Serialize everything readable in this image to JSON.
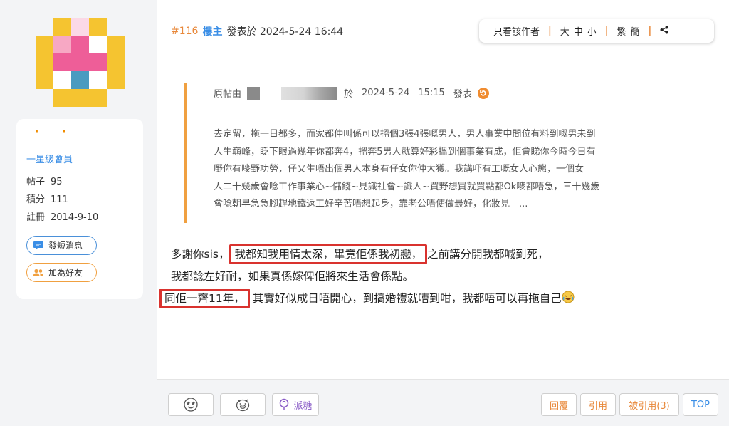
{
  "post": {
    "floor": "#116",
    "author_role": "樓主",
    "posted_at": "發表於 2024-5-24 16:44"
  },
  "toolbar": {
    "author_only": "只看該作者",
    "font_size": "大中小",
    "script": "繁簡"
  },
  "profile": {
    "rank": "一星級會員",
    "posts_label": "帖子",
    "posts_value": "95",
    "points_label": "積分",
    "points_value": "111",
    "registered_label": "註冊",
    "registered_value": "2014-9-10",
    "send_message": "發短消息",
    "add_friend": "加為好友"
  },
  "quote": {
    "prefix": "原帖由",
    "at": "於",
    "date": "2024-5-24",
    "time": "15:15",
    "suffix": "發表",
    "lines": [
      "去定留，拖一日都多，而家都仲叫係可以搵個3張4張嘅男人，男人事業中間位有料到嘅男未到",
      "人生巔峰，眨下眼過幾年你都奔4，搵奔5男人就算好彩搵到個事業有成，佢會睇你今時今日有",
      "嘢你有嘜野功勞，仔又生唔出個男人本身有仔女你仲大獲。我講吓有工嘅女人心態，一個女",
      "人二十幾歲會唸工作事業心~儲錢~見識社會~識人~買野想買就買點都Ok嘜都唔急，三十幾歲",
      "會唸朝早急急腳趕地鐵返工好辛苦唔想起身，靠老公唔使做最好，化妝見　..."
    ]
  },
  "reply": {
    "line1_a": "多謝你sis，",
    "line1_highlight": "我都知我用情太深，畢竟佢係我初戀，",
    "line1_b": "之前講分開我都喊到死，",
    "line2": "我都諗左好耐，如果真係嫁俾佢將來生活會係點。",
    "line3_highlight": "同佢一齊11年，",
    "line3_b": "其實好似成日唔開心，到搞婚禮就嘈到咁，我都唔可以再拖自己"
  },
  "footer": {
    "candy": "派糖",
    "reply": "回覆",
    "quote": "引用",
    "quoted": "被引用(3)",
    "top": "TOP"
  },
  "colors": {
    "accent_orange": "#e8883a",
    "link_blue": "#3a8ee6",
    "highlight_red": "#d9322e",
    "sidebar_bg": "#f3f4f6"
  }
}
